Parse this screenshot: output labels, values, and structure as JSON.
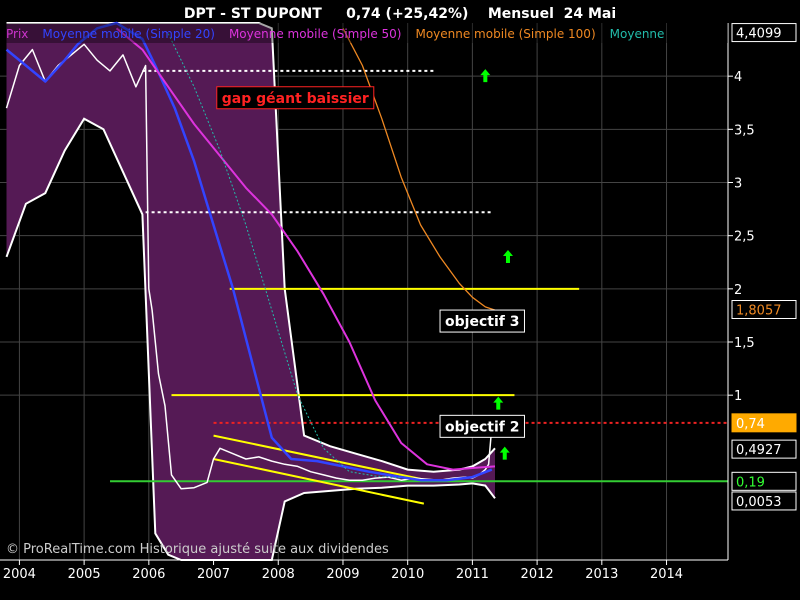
{
  "chart_data": {
    "type": "line",
    "title": "DPT - ST DUPONT     0,74 (+25,42%)    Mensuel  24 Mai",
    "xlabel": "",
    "ylabel": "",
    "xlim": [
      2003.7,
      2014.95
    ],
    "ylim": [
      -0.55,
      4.5
    ],
    "grid": true,
    "x_ticks": [
      {
        "value": 2004,
        "label": "2004"
      },
      {
        "value": 2005,
        "label": "2005"
      },
      {
        "value": 2006,
        "label": "2006"
      },
      {
        "value": 2007,
        "label": "2007"
      },
      {
        "value": 2008,
        "label": "2008"
      },
      {
        "value": 2009,
        "label": "2009"
      },
      {
        "value": 2010,
        "label": "2010"
      },
      {
        "value": 2011,
        "label": "2011"
      },
      {
        "value": 2012,
        "label": "2012"
      },
      {
        "value": 2013,
        "label": "2013"
      },
      {
        "value": 2014,
        "label": "2014"
      }
    ],
    "y_ticks": [
      {
        "value": 4,
        "label": "4"
      },
      {
        "value": 3.5,
        "label": "3,5"
      },
      {
        "value": 3,
        "label": "3"
      },
      {
        "value": 2.5,
        "label": "2,5"
      },
      {
        "value": 2,
        "label": "2"
      },
      {
        "value": 1.5,
        "label": "1,5"
      },
      {
        "value": 1,
        "label": "1"
      }
    ],
    "legend": [
      {
        "name": "Prix",
        "color": "#cc33cc"
      },
      {
        "name": "Moyenne mobile (Simple 20)",
        "color": "#3344ff"
      },
      {
        "name": "Moyenne mobile (Simple 50)",
        "color": "#dd33dd"
      },
      {
        "name": "Moyenne mobile (Simple 100)",
        "color": "#ee8822"
      },
      {
        "name": "Moyenne",
        "color": "#22bbaa"
      }
    ],
    "price_markers": [
      {
        "label": "4,4099",
        "value": 4.41,
        "bg": "#000000",
        "fg": "#ffffff",
        "border": "#ffffff"
      },
      {
        "label": "1,8057",
        "value": 1.8057,
        "bg": "#000000",
        "fg": "#ee8822",
        "border": "#ffffff"
      },
      {
        "label": "0,74",
        "value": 0.74,
        "bg": "#ffaa00",
        "fg": "#ffffff",
        "border": "#ffaa00"
      },
      {
        "label": "0,4927",
        "value": 0.4927,
        "bg": "#000000",
        "fg": "#ffffff",
        "border": "#ffffff"
      },
      {
        "label": "0,19",
        "value": 0.19,
        "bg": "#000000",
        "fg": "#33ff33",
        "border": "#ffffff"
      },
      {
        "label": "0,0053",
        "value": 0.0053,
        "bg": "#000000",
        "fg": "#ffffff",
        "border": "#ffffff"
      }
    ],
    "annotations": [
      {
        "text": "gap géant baissier",
        "x": 2007.05,
        "y": 3.75,
        "fg": "#ff2222",
        "bg": "#000000",
        "border": "#ff2222"
      },
      {
        "text": "objectif 3",
        "x": 2010.5,
        "y": 1.65,
        "fg": "#ffffff",
        "bg": "#000000",
        "border": "#ffffff"
      },
      {
        "text": "objectif 2",
        "x": 2010.5,
        "y": 0.66,
        "fg": "#ffffff",
        "bg": "#000000",
        "border": "#ffffff"
      }
    ],
    "footer": "© ProRealTime.com Historique ajusté suite aux dividendes",
    "series": [
      {
        "name": "Prix",
        "color": "#ffffff",
        "x": [
          2003.8,
          2004.0,
          2004.2,
          2004.4,
          2004.6,
          2004.8,
          2005.0,
          2005.2,
          2005.4,
          2005.6,
          2005.8,
          2005.95,
          2006.0,
          2006.05,
          2006.15,
          2006.25,
          2006.35,
          2006.5,
          2006.7,
          2006.9,
          2007.0,
          2007.1,
          2007.3,
          2007.5,
          2007.7,
          2007.9,
          2008.1,
          2008.3,
          2008.5,
          2008.7,
          2008.9,
          2009.1,
          2009.3,
          2009.5,
          2009.7,
          2009.9,
          2010.1,
          2010.3,
          2010.5,
          2010.7,
          2010.9,
          2011.0,
          2011.1,
          2011.2,
          2011.25,
          2011.3,
          2011.35
        ],
        "y": [
          3.7,
          4.1,
          4.25,
          3.95,
          4.1,
          4.2,
          4.3,
          4.15,
          4.05,
          4.2,
          3.9,
          4.1,
          2.0,
          1.8,
          1.2,
          0.9,
          0.25,
          0.12,
          0.13,
          0.18,
          0.4,
          0.5,
          0.45,
          0.4,
          0.42,
          0.38,
          0.35,
          0.33,
          0.28,
          0.25,
          0.22,
          0.2,
          0.2,
          0.22,
          0.23,
          0.2,
          0.22,
          0.21,
          0.2,
          0.22,
          0.23,
          0.22,
          0.25,
          0.3,
          0.35,
          0.7,
          0.74
        ]
      },
      {
        "name": "Moyenne mobile (Simple 20)",
        "color": "#3344ff",
        "x": [
          2003.8,
          2004.1,
          2004.4,
          2004.7,
          2004.9,
          2005.2,
          2005.5,
          2005.9,
          2006.1,
          2006.4,
          2006.7,
          2007.0,
          2007.3,
          2007.6,
          2007.9,
          2008.2,
          2008.6,
          2009.0,
          2009.4,
          2009.8,
          2010.2,
          2010.6,
          2011.0,
          2011.3
        ],
        "y": [
          4.25,
          4.1,
          3.95,
          4.15,
          4.3,
          4.45,
          4.5,
          4.35,
          4.1,
          3.7,
          3.2,
          2.6,
          2.0,
          1.3,
          0.6,
          0.4,
          0.38,
          0.33,
          0.28,
          0.24,
          0.2,
          0.2,
          0.23,
          0.3
        ]
      },
      {
        "name": "Moyenne mobile (Simple 50)",
        "color": "#dd33dd",
        "x": [
          2005.5,
          2005.9,
          2006.3,
          2006.7,
          2007.1,
          2007.5,
          2007.9,
          2008.3,
          2008.7,
          2009.1,
          2009.5,
          2009.9,
          2010.3,
          2010.7,
          2011.1,
          2011.35
        ],
        "y": [
          4.45,
          4.25,
          3.9,
          3.55,
          3.25,
          2.95,
          2.7,
          2.35,
          1.95,
          1.5,
          0.95,
          0.55,
          0.35,
          0.3,
          0.32,
          0.33
        ]
      },
      {
        "name": "Moyenne mobile (Simple 100)",
        "color": "#ee8822",
        "x": [
          2009.0,
          2009.3,
          2009.6,
          2009.9,
          2010.2,
          2010.5,
          2010.8,
          2011.0,
          2011.2,
          2011.35
        ],
        "y": [
          4.45,
          4.1,
          3.6,
          3.05,
          2.6,
          2.3,
          2.05,
          1.92,
          1.83,
          1.8
        ]
      },
      {
        "name": "Moyenne",
        "color": "#22bbaa",
        "x": [
          2006.3,
          2006.7,
          2007.1,
          2007.5,
          2007.9,
          2008.3,
          2008.7,
          2009.1,
          2009.5,
          2009.9
        ],
        "y": [
          4.4,
          3.9,
          3.3,
          2.6,
          1.8,
          1.0,
          0.5,
          0.28,
          0.24,
          0.22
        ]
      }
    ],
    "bollinger": {
      "x": [
        2003.8,
        2004.1,
        2004.4,
        2004.7,
        2005.0,
        2005.3,
        2005.6,
        2005.9,
        2006.1,
        2006.3,
        2006.5,
        2006.8,
        2007.1,
        2007.4,
        2007.7,
        2007.9,
        2008.1,
        2008.4,
        2008.8,
        2009.2,
        2009.6,
        2010.0,
        2010.4,
        2010.8,
        2011.0,
        2011.2,
        2011.35
      ],
      "upper": [
        4.5,
        4.5,
        4.5,
        4.5,
        4.5,
        4.5,
        4.5,
        4.5,
        4.5,
        4.5,
        4.5,
        4.5,
        4.5,
        4.5,
        4.5,
        4.45,
        2.0,
        0.62,
        0.52,
        0.45,
        0.38,
        0.3,
        0.28,
        0.3,
        0.33,
        0.4,
        0.5
      ],
      "lower": [
        2.3,
        2.8,
        2.9,
        3.3,
        3.6,
        3.5,
        3.1,
        2.7,
        -0.3,
        -0.5,
        -0.55,
        -0.55,
        -0.55,
        -0.55,
        -0.55,
        -0.55,
        0.0,
        0.08,
        0.1,
        0.12,
        0.13,
        0.15,
        0.15,
        0.16,
        0.17,
        0.15,
        0.03
      ]
    },
    "levels": [
      {
        "name": "dotted-4",
        "y": 4.05,
        "x1": 2005.9,
        "x2": 2010.4,
        "color": "#ffffff",
        "dash": true
      },
      {
        "name": "dotted-2-7",
        "y": 2.72,
        "x1": 2005.95,
        "x2": 2011.3,
        "color": "#ffffff",
        "dash": true
      },
      {
        "name": "objectif-3-line",
        "y": 2.0,
        "x1": 2007.25,
        "x2": 2012.65,
        "color": "#ffff00",
        "dash": false
      },
      {
        "name": "objectif-2-line",
        "y": 1.0,
        "x1": 2006.35,
        "x2": 2011.65,
        "color": "#ffff00",
        "dash": false
      },
      {
        "name": "red-resistance",
        "y": 0.74,
        "x1": 2007.0,
        "x2": 2014.95,
        "color": "#ee2222",
        "dash": true
      },
      {
        "name": "green-support",
        "y": 0.19,
        "x1": 2005.4,
        "x2": 2014.95,
        "color": "#33cc33",
        "dash": false
      }
    ],
    "trendlines": [
      {
        "name": "channel-top",
        "x1": 2007.0,
        "y1": 0.62,
        "x2": 2010.3,
        "y2": 0.2,
        "color": "#ffff00"
      },
      {
        "name": "channel-bottom",
        "x1": 2007.0,
        "y1": 0.4,
        "x2": 2010.25,
        "y2": -0.02,
        "color": "#ffff00"
      }
    ],
    "arrows": [
      {
        "x": 2011.2,
        "y": 4.0,
        "color": "#00ff00"
      },
      {
        "x": 2011.55,
        "y": 2.3,
        "color": "#00ff00"
      },
      {
        "x": 2011.4,
        "y": 0.92,
        "color": "#00ff00"
      },
      {
        "x": 2011.5,
        "y": 0.45,
        "color": "#00ff00"
      }
    ]
  }
}
